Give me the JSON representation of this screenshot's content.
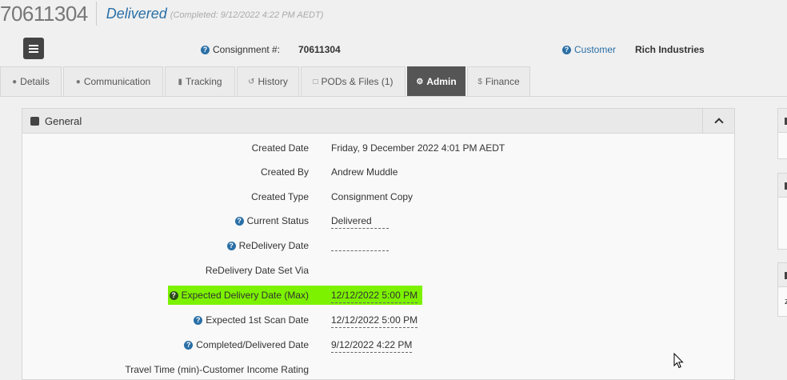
{
  "header": {
    "consignment_number": "70611304",
    "status": "Delivered",
    "completed_note": "(Completed: 9/12/2022 4:22 PM AEDT)"
  },
  "info": {
    "consignment_label": "Consignment #:",
    "consignment_value": "70611304",
    "customer_label": "Customer",
    "customer_value": "Rich Industries"
  },
  "tabs": [
    {
      "label": "Details",
      "icon": "user-icon"
    },
    {
      "label": "Communication",
      "icon": "comment-icon"
    },
    {
      "label": "Tracking",
      "icon": "truck-icon"
    },
    {
      "label": "History",
      "icon": "history-icon"
    },
    {
      "label": "PODs & Files (1)",
      "icon": "file-icon"
    },
    {
      "label": "Admin",
      "icon": "gear-icon",
      "active": true
    },
    {
      "label": "Finance",
      "icon": "dollar-icon"
    }
  ],
  "panel": {
    "title": "General",
    "rows": [
      {
        "label": "Created Date",
        "value": "Friday, 9 December 2022 4:01 PM AEDT"
      },
      {
        "label": "Created By",
        "value": "Andrew Muddle"
      },
      {
        "label": "Created Type",
        "value": "Consignment Copy"
      },
      {
        "label": "Current Status",
        "value": "Delivered"
      },
      {
        "label": "ReDelivery Date",
        "value": ""
      },
      {
        "label": "ReDelivery Date Set Via",
        "value": ""
      },
      {
        "label": "Expected Delivery Date (Max)",
        "value": "12/12/2022 5:00 PM"
      },
      {
        "label": "Expected 1st Scan Date",
        "value": "12/12/2022 5:00 PM"
      },
      {
        "label": "Completed/Delivered Date",
        "value": "9/12/2022 4:22 PM"
      },
      {
        "label": "Travel Time (min)-Customer Income Rating",
        "value": ""
      }
    ]
  },
  "right_stub_letter": "z",
  "colors": {
    "accent": "#2a6fa6",
    "highlight": "#7cf200",
    "active_tab": "#555555"
  }
}
